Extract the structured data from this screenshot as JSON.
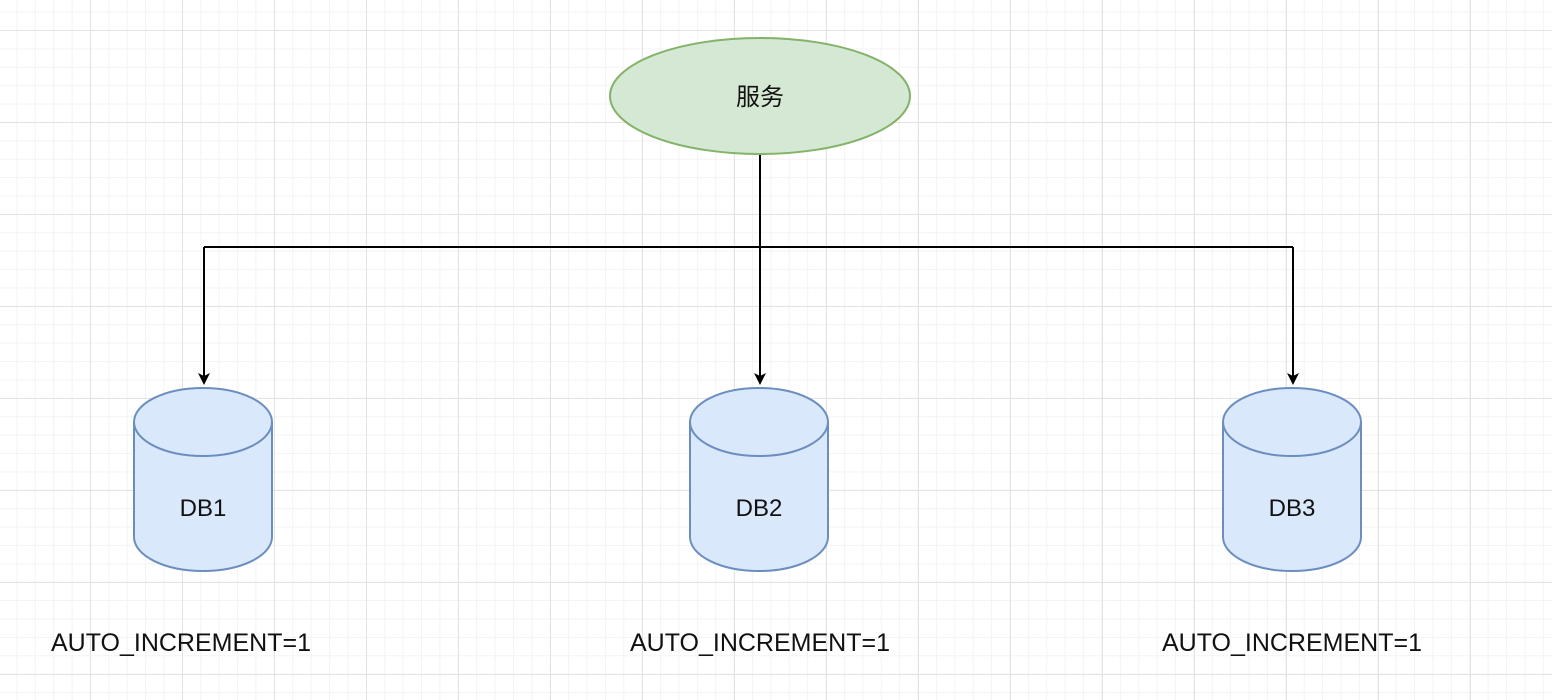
{
  "service": {
    "label": "服务",
    "fill": "#d5e8d4",
    "stroke": "#82b366"
  },
  "databases": [
    {
      "label": "DB1",
      "caption": "AUTO_INCREMENT=1"
    },
    {
      "label": "DB2",
      "caption": "AUTO_INCREMENT=1"
    },
    {
      "label": "DB3",
      "caption": "AUTO_INCREMENT=1"
    }
  ],
  "colors": {
    "db_fill": "#dae8fc",
    "db_stroke": "#6c8ebf",
    "edge": "#000000"
  }
}
